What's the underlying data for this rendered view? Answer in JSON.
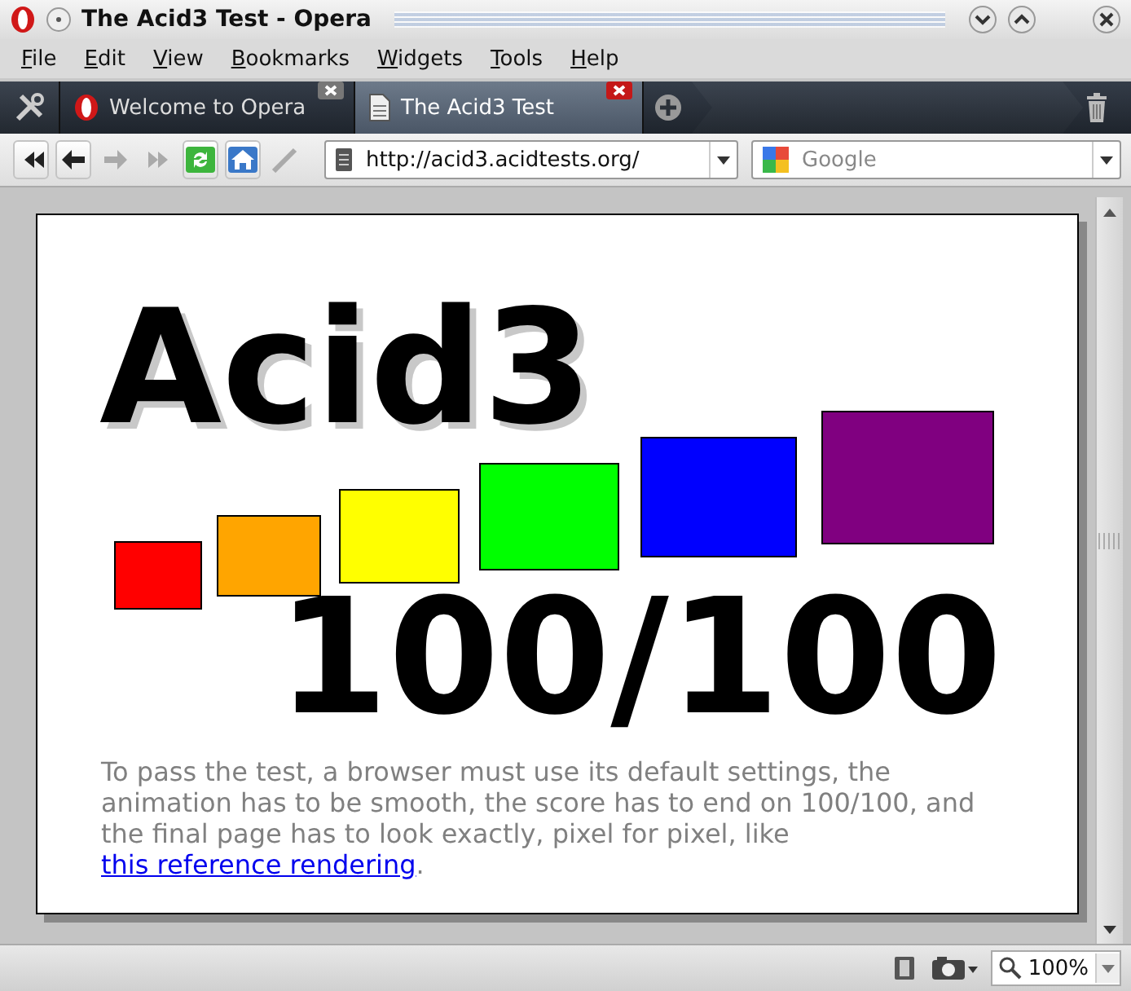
{
  "window": {
    "title": "The Acid3 Test - Opera"
  },
  "menu": [
    {
      "label": "File"
    },
    {
      "label": "Edit"
    },
    {
      "label": "View"
    },
    {
      "label": "Bookmarks"
    },
    {
      "label": "Widgets"
    },
    {
      "label": "Tools"
    },
    {
      "label": "Help"
    }
  ],
  "tabs": [
    {
      "title": "Welcome to Opera",
      "kind": "opera",
      "selected": false
    },
    {
      "title": "The Acid3 Test",
      "kind": "page",
      "selected": true
    }
  ],
  "toolbar": {
    "buttons": [
      {
        "kind": "rewind",
        "disabled": false
      },
      {
        "kind": "back",
        "disabled": false
      },
      {
        "kind": "forward",
        "disabled": true
      },
      {
        "kind": "fastforward",
        "disabled": true
      },
      {
        "kind": "reload",
        "disabled": false
      },
      {
        "kind": "home",
        "disabled": false
      },
      {
        "kind": "wand",
        "disabled": true
      }
    ],
    "address": {
      "value": "http://acid3.acidtests.org/"
    },
    "search": {
      "placeholder": "Google"
    }
  },
  "page": {
    "heading": "Acid3",
    "squares": [
      {
        "color": "#ff0000"
      },
      {
        "color": "#ffa500"
      },
      {
        "color": "#ffff00"
      },
      {
        "color": "#00ff00"
      },
      {
        "color": "#0000ff"
      },
      {
        "color": "#800080"
      }
    ],
    "score": "100/100",
    "text": "To pass the test, a browser must use its default settings, the animation has to be smooth, the score has to end on 100/100, and the final page has to look exactly, pixel for pixel, like ",
    "link": "this reference rendering",
    "text_end": "."
  },
  "status_bar": {
    "zoom": "100%"
  }
}
